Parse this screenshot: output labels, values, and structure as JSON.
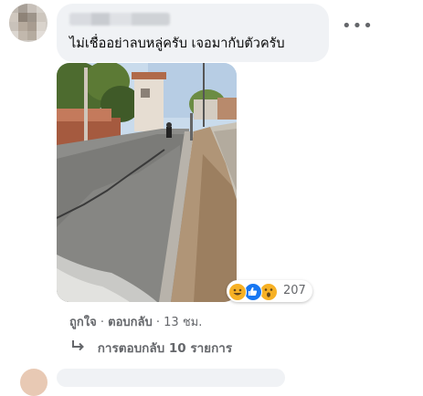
{
  "comment": {
    "text": "ไม่เชื่ออย่าลบหลู่ครับ เจอมากับตัวครับ",
    "more_icon": "more-horizontal-icon"
  },
  "reactions": {
    "icons": [
      "haha-icon",
      "like-icon",
      "wow-icon"
    ],
    "count": "207",
    "colors": {
      "haha": "#f7b125",
      "like": "#1877f2",
      "wow": "#f7b125"
    }
  },
  "actions": {
    "like": "ถูกใจ",
    "separator": "·",
    "reply": "ตอบกลับ",
    "time": "13 ชม."
  },
  "replies": {
    "label": "การตอบกลับ 10 รายการ"
  }
}
